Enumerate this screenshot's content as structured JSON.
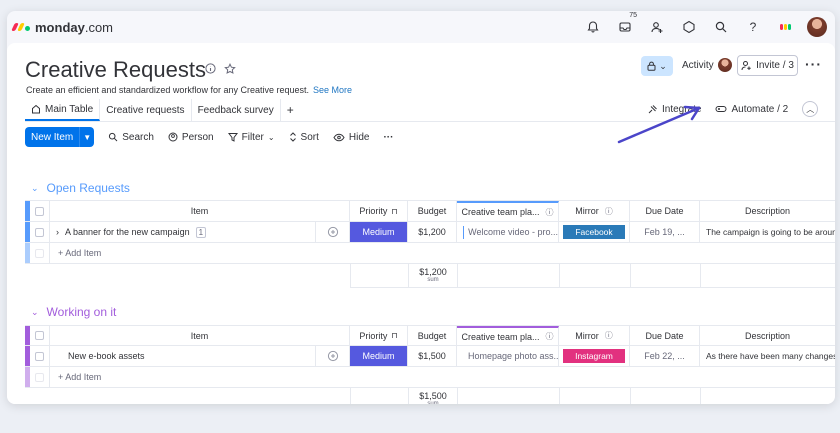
{
  "app": {
    "logo_brand": "monday",
    "logo_suffix": ".com"
  },
  "topbar": {
    "inbox_count": "75"
  },
  "board": {
    "title": "Creative Requests",
    "subtitle": "Create an efficient and standardized workflow for any Creative request.",
    "see_more": "See More",
    "activity_label": "Activity",
    "invite_label": "Invite / 3"
  },
  "tabs": [
    {
      "label": "Main Table",
      "icon": "home-icon"
    },
    {
      "label": "Creative requests"
    },
    {
      "label": "Feedback survey"
    }
  ],
  "tab_add": "+",
  "actions": {
    "integrate": "Integrate",
    "automate": "Automate / 2"
  },
  "toolbar": {
    "new_item": "New Item",
    "search": "Search",
    "person": "Person",
    "filter": "Filter",
    "sort": "Sort",
    "hide": "Hide"
  },
  "columns": {
    "item": "Item",
    "priority": "Priority",
    "budget": "Budget",
    "creative": "Creative team pla...",
    "mirror": "Mirror",
    "due_date": "Due Date",
    "description": "Description"
  },
  "groups": [
    {
      "name": "Open Requests",
      "color": "#579bfc",
      "row": {
        "item": "A banner for the new campaign",
        "subitems": "1",
        "priority": "Medium",
        "priority_color": "#5559df",
        "budget": "$1,200",
        "creative": "Welcome video - pro...",
        "mirror": "Facebook",
        "mirror_color": "#2a7ab8",
        "due_date": "Feb 19, ...",
        "description": "The campaign is going to be around ..."
      },
      "add_item": "+ Add Item",
      "sum_value": "$1,200",
      "sum_label": "sum"
    },
    {
      "name": "Working on it",
      "color": "#a25ddc",
      "row": {
        "item": "New e-book assets",
        "priority": "Medium",
        "priority_color": "#5559df",
        "budget": "$1,500",
        "creative": "Homepage photo ass...",
        "mirror": "Instagram",
        "mirror_color": "#e2317f",
        "due_date": "Feb 22, ...",
        "description": "As there have been many changes i..."
      },
      "add_item": "+ Add Item",
      "sum_value": "$1,500",
      "sum_label": "sum"
    }
  ],
  "colors": {
    "accent": "#0073ea",
    "annotation_arrow": "#4b45c9"
  }
}
